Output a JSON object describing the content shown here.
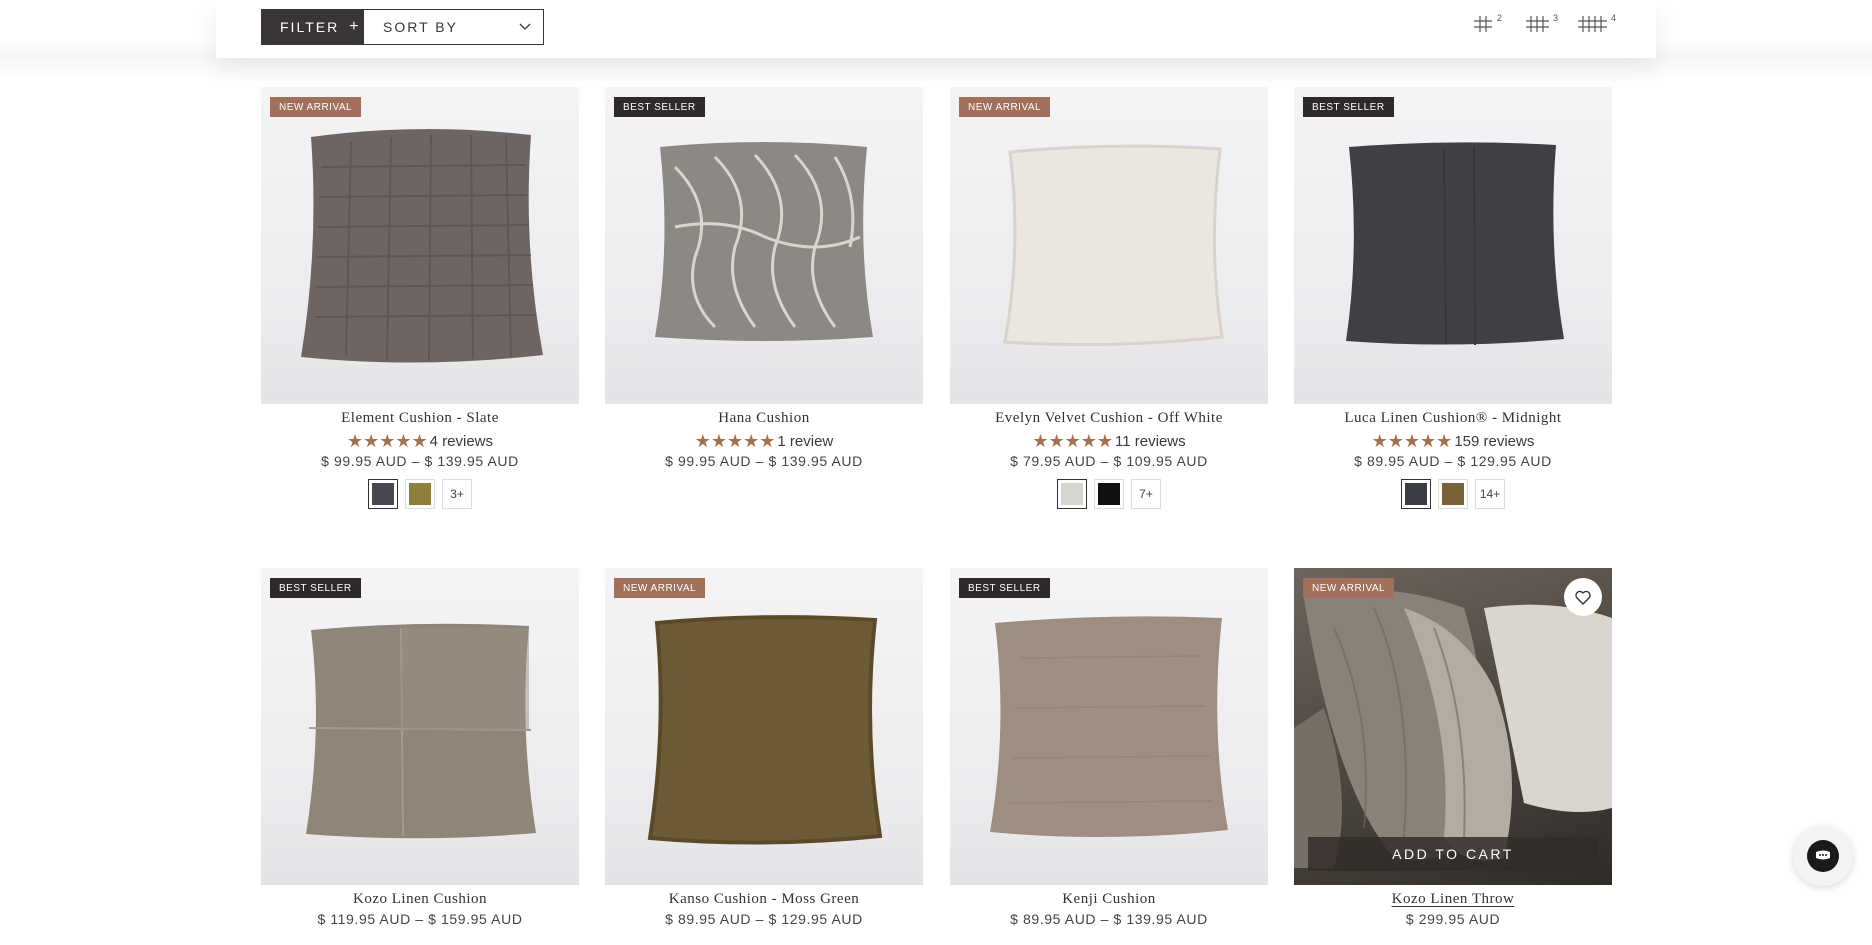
{
  "toolbar": {
    "filter_label": "FILTER",
    "filter_icon": "plus-icon",
    "sort_label": "SORT BY",
    "sort_icon": "chevron-down-icon",
    "grid_options": [
      {
        "icon": "grid-2-icon",
        "count": "2"
      },
      {
        "icon": "grid-3-icon",
        "count": "3"
      },
      {
        "icon": "grid-4-icon",
        "count": "4"
      }
    ]
  },
  "products": [
    {
      "badge": "NEW ARRIVAL",
      "name": "Element Cushion - Slate",
      "review_text": "4 reviews",
      "price": "$ 99.95 AUD – $ 139.95 AUD",
      "swatch_colors": [
        "#4a4750",
        "#8f7f3c"
      ],
      "more": "3+",
      "pillow_color": "#6e6562"
    },
    {
      "badge": "BEST SELLER",
      "name": "Hana Cushion",
      "review_text": "1 review",
      "price": "$ 99.95 AUD – $ 139.95 AUD",
      "swatch_colors": [],
      "more": "",
      "pillow_color": "#8c8884"
    },
    {
      "badge": "NEW ARRIVAL",
      "name": "Evelyn Velvet Cushion - Off White",
      "review_text": "11 reviews",
      "price": "$ 79.95 AUD – $ 109.95 AUD",
      "swatch_colors": [
        "#d8d4cf",
        "#111111"
      ],
      "more": "7+",
      "pillow_color": "#ece8e1"
    },
    {
      "badge": "BEST SELLER",
      "name": "Luca Linen Cushion® - Midnight",
      "review_text": "159 reviews",
      "price": "$ 89.95 AUD – $ 129.95 AUD",
      "swatch_colors": [
        "#3b3d45",
        "#7a6238"
      ],
      "more": "14+",
      "pillow_color": "#3f3f44"
    },
    {
      "badge": "BEST SELLER",
      "name": "Kozo Linen Cushion",
      "review_text": "",
      "price": "$ 119.95 AUD – $ 159.95 AUD",
      "swatch_colors": [],
      "more": "",
      "pillow_color": "#8f8579"
    },
    {
      "badge": "NEW ARRIVAL",
      "name": "Kanso Cushion - Moss Green",
      "review_text": "",
      "price": "$ 89.95 AUD – $ 129.95 AUD",
      "swatch_colors": [],
      "more": "",
      "pillow_color": "#6b5a34"
    },
    {
      "badge": "BEST SELLER",
      "name": "Kenji Cushion",
      "review_text": "",
      "price": "$ 89.95 AUD – $ 139.95 AUD",
      "swatch_colors": [],
      "more": "",
      "pillow_color": "#9d8e81"
    },
    {
      "badge": "NEW ARRIVAL",
      "name": "Kozo Linen Throw",
      "review_text": "",
      "price": "$ 299.95 AUD",
      "swatch_colors": [],
      "more": "",
      "pillow_color": "#8a8278",
      "add_to_cart": "ADD TO CART",
      "wishlist_icon": "heart-icon"
    }
  ],
  "chat": {
    "icon": "chat-icon"
  }
}
